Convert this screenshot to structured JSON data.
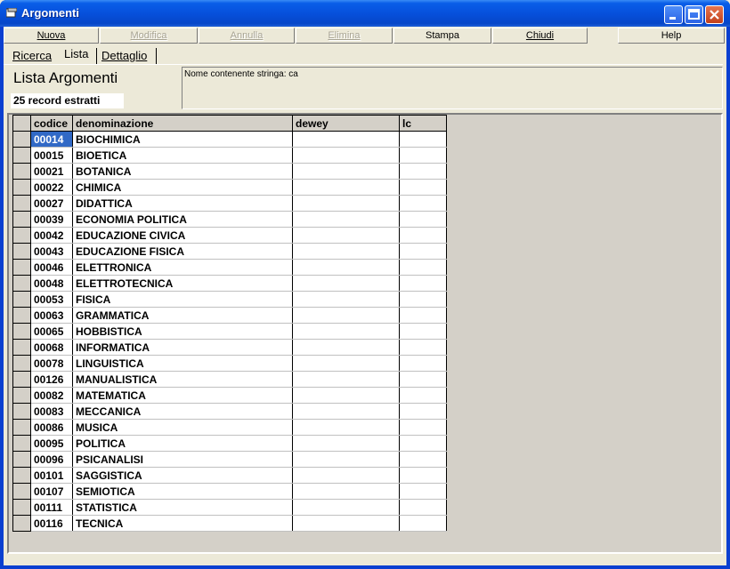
{
  "window": {
    "title": "Argomenti"
  },
  "menu": {
    "nuova": "Nuova",
    "modifica": "Modifica",
    "annulla": "Annulla",
    "elimina": "Elimina",
    "stampa": "Stampa",
    "chiudi": "Chiudi",
    "help": "Help"
  },
  "tabs": {
    "ricerca": "Ricerca",
    "lista": "Lista",
    "dettaglio": "Dettaglio"
  },
  "header": {
    "list_title": "Lista Argomenti",
    "record_count": "25 record estratti",
    "filter_text": "Nome contenente stringa: ca"
  },
  "grid": {
    "columns": {
      "codice": "codice",
      "denominazione": "denominazione",
      "dewey": "dewey",
      "lc": "lc"
    },
    "rows": [
      {
        "codice": "00014",
        "denominazione": "BIOCHIMICA"
      },
      {
        "codice": "00015",
        "denominazione": "BIOETICA"
      },
      {
        "codice": "00021",
        "denominazione": "BOTANICA"
      },
      {
        "codice": "00022",
        "denominazione": "CHIMICA"
      },
      {
        "codice": "00027",
        "denominazione": "DIDATTICA"
      },
      {
        "codice": "00039",
        "denominazione": "ECONOMIA POLITICA"
      },
      {
        "codice": "00042",
        "denominazione": "EDUCAZIONE CIVICA"
      },
      {
        "codice": "00043",
        "denominazione": "EDUCAZIONE FISICA"
      },
      {
        "codice": "00046",
        "denominazione": "ELETTRONICA"
      },
      {
        "codice": "00048",
        "denominazione": "ELETTROTECNICA"
      },
      {
        "codice": "00053",
        "denominazione": "FISICA"
      },
      {
        "codice": "00063",
        "denominazione": "GRAMMATICA"
      },
      {
        "codice": "00065",
        "denominazione": "HOBBISTICA"
      },
      {
        "codice": "00068",
        "denominazione": "INFORMATICA"
      },
      {
        "codice": "00078",
        "denominazione": "LINGUISTICA"
      },
      {
        "codice": "00126",
        "denominazione": "MANUALISTICA"
      },
      {
        "codice": "00082",
        "denominazione": "MATEMATICA"
      },
      {
        "codice": "00083",
        "denominazione": "MECCANICA"
      },
      {
        "codice": "00086",
        "denominazione": "MUSICA"
      },
      {
        "codice": "00095",
        "denominazione": "POLITICA"
      },
      {
        "codice": "00096",
        "denominazione": "PSICANALISI"
      },
      {
        "codice": "00101",
        "denominazione": "SAGGISTICA"
      },
      {
        "codice": "00107",
        "denominazione": "SEMIOTICA"
      },
      {
        "codice": "00111",
        "denominazione": "STATISTICA"
      },
      {
        "codice": "00116",
        "denominazione": "TECNICA"
      }
    ]
  }
}
